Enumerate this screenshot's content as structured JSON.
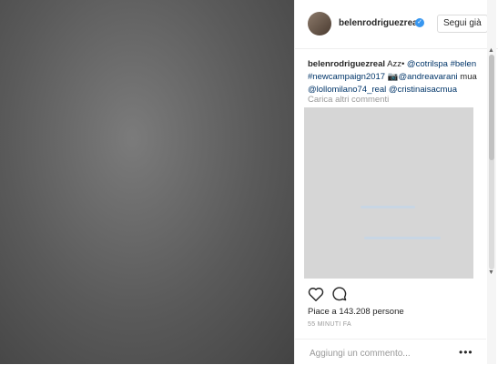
{
  "post": {
    "username": "belenrodriguezreal",
    "follow_label": "Segui già",
    "caption": {
      "text_1": " Azz• ",
      "mention_1": "@cotrilspa",
      "tag_1": "#belen",
      "tag_2": "#newcampaign2017",
      "camera_glyph": "📷",
      "mention_2": "@andreavarani",
      "text_2": " mua ",
      "mention_3": "@lollomilano74_real",
      "mention_4": "@cristinaisacmua"
    },
    "load_more": "Carica altri commenti",
    "likes": "Piace a 143.208 persone",
    "time": "55 MINUTI FA",
    "comment_placeholder": "Aggiungi un commento...",
    "more_glyph": "•••"
  },
  "icons": {
    "like": "heart-icon",
    "comment": "comment-icon",
    "verified": "verified-badge-icon"
  },
  "colors": {
    "link": "#003569",
    "verified": "#3897f0",
    "muted": "#999999"
  }
}
